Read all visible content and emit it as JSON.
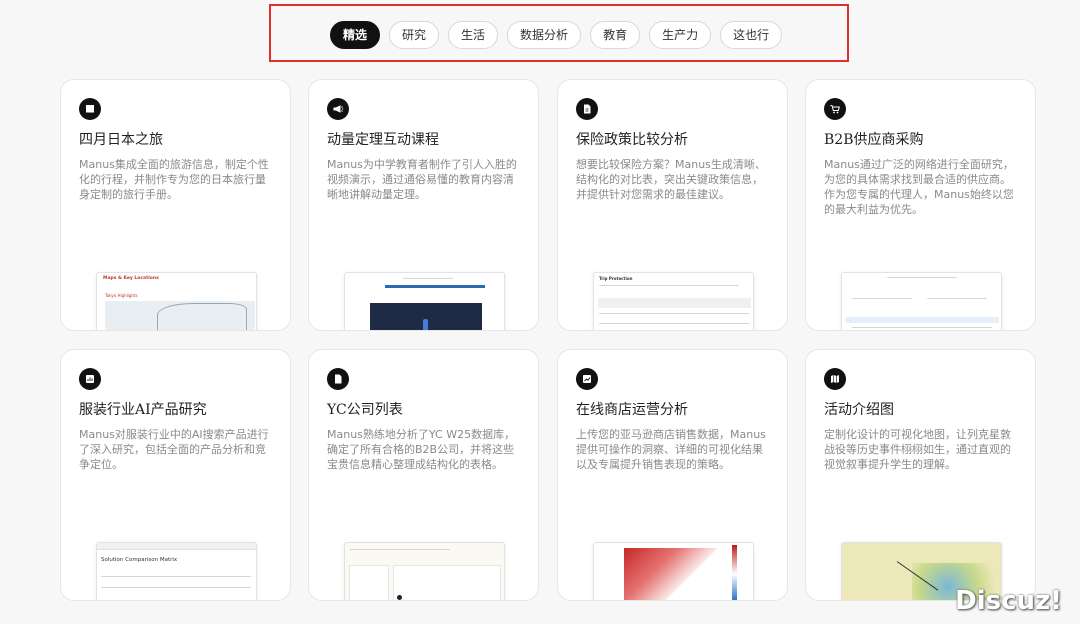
{
  "tabs": [
    {
      "label": "精选",
      "active": true
    },
    {
      "label": "研究",
      "active": false
    },
    {
      "label": "生活",
      "active": false
    },
    {
      "label": "数据分析",
      "active": false
    },
    {
      "label": "教育",
      "active": false
    },
    {
      "label": "生产力",
      "active": false
    },
    {
      "label": "这也行",
      "active": false
    }
  ],
  "cards": [
    {
      "icon": "book-icon",
      "title": "四月日本之旅",
      "desc": "Manus集成全面的旅游信息，制定个性化的行程，并制作专为您的日本旅行量身定制的旅行手册。",
      "thumb_title": "Maps & Key Locations",
      "thumb_sub": "Tokyo Highlights"
    },
    {
      "icon": "megaphone-icon",
      "title": "动量定理互动课程",
      "desc": "Manus为中学教育者制作了引人入胜的视频演示，通过通俗易懂的教育内容清晰地讲解动量定理。"
    },
    {
      "icon": "document-icon",
      "title": "保险政策比较分析",
      "desc": "想要比较保险方案？Manus生成清晰、结构化的对比表，突出关键政策信息，并提供针对您需求的最佳建议。",
      "thumb_title": "Trip Protection"
    },
    {
      "icon": "cart-icon",
      "title": "B2B供应商采购",
      "desc": "Manus通过广泛的网络进行全面研究，为您的具体需求找到最合适的供应商。作为您专属的代理人，Manus始终以您的最大利益为优先。"
    },
    {
      "icon": "chart-box-icon",
      "title": "服装行业AI产品研究",
      "desc": "Manus对服装行业中的AI搜索产品进行了深入研究，包括全面的产品分析和竞争定位。",
      "thumb_title": "Solution Comparison Matrix"
    },
    {
      "icon": "file-icon",
      "title": "YC公司列表",
      "desc": "Manus熟练地分析了YC W25数据库，确定了所有合格的B2B公司，并将这些宝贵信息精心整理成结构化的表格。"
    },
    {
      "icon": "analytics-icon",
      "title": "在线商店运营分析",
      "desc": "上传您的亚马逊商店销售数据，Manus提供可操作的洞察、详细的可视化结果以及专属提升销售表现的策略。"
    },
    {
      "icon": "map-icon",
      "title": "活动介绍图",
      "desc": "定制化设计的可视化地图，让列克星敦战役等历史事件栩栩如生，通过直观的视觉叙事提升学生的理解。"
    }
  ],
  "watermark": "Discuz!",
  "colors": {
    "accent_frame": "#e0302a",
    "tab_active": "#111111"
  }
}
